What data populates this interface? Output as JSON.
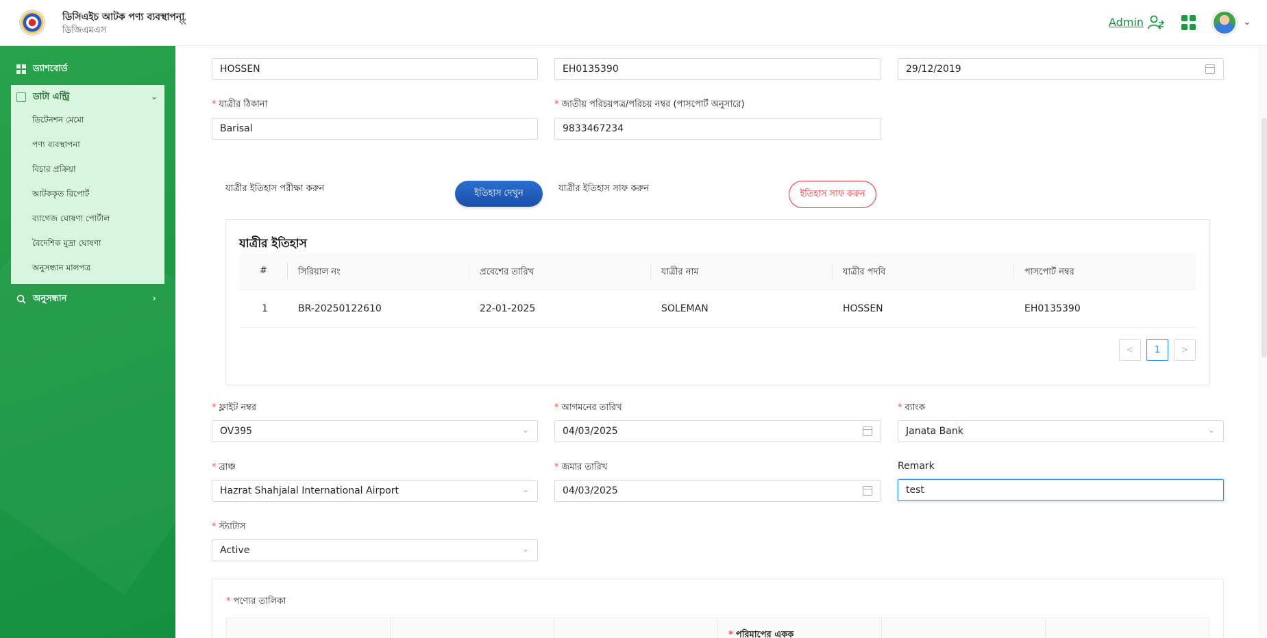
{
  "header": {
    "app_title": "ডিসিএইচ আটক পণ্য ব্যবস্থাপনা",
    "app_subtitle": "ডিজিএমএস",
    "admin_label": "Admin"
  },
  "sidebar": {
    "dashboard": "ড্যাশবোর্ড",
    "data_entry": "ডাটা এন্ট্রি",
    "submenu": [
      "ডিটেনশন মেমো",
      "পণ্য ব্যবস্থাপনা",
      "বিচার প্রক্রিয়া",
      "আটককৃত রিপোর্ট",
      "ব্যাগেজ ঘোষণা পোর্টাল",
      "বৈদেশিক মুদ্রা ঘোষণা",
      "অনুসন্ধান মালপত্র"
    ],
    "search": "অনুসন্ধান"
  },
  "form": {
    "top_row": {
      "field1_value": "HOSSEN",
      "field2_value": "EH0135390",
      "field3_value": "29/12/2019"
    },
    "address_label": "যাত্রীর ঠিকানা",
    "address_value": "Barisal",
    "nid_label": "জাতীয় পরিচয়পত্র/পরিচয় নম্বর (পাসপোর্ট অনুসারে)",
    "nid_value": "9833467234",
    "check_history_label": "যাত্রীর ইতিহাস পরীক্ষা করুন",
    "view_history_button": "ইতিহাস দেখুন",
    "clear_history_label": "যাত্রীর ইতিহাস সাফ করুন",
    "clear_history_button": "ইতিহাস সাফ করুন",
    "flight_label": "ফ্লাইট নম্বর",
    "flight_value": "OV395",
    "arrival_label": "আগমনের তারিখ",
    "arrival_value": "04/03/2025",
    "bank_label": "ব্যাংক",
    "bank_value": "Janata Bank",
    "branch_label": "ব্রাঞ্চ",
    "branch_value": "Hazrat Shahjalal International Airport",
    "deposit_label": "জমার তারিখ",
    "deposit_value": "04/03/2025",
    "remark_label": "Remark",
    "remark_value": "test",
    "status_label": "স্ট্যাটাস",
    "status_value": "Active",
    "product_list_label": "পণ্যের তালিকা",
    "unit_col_label": "পরিমাপের একক"
  },
  "history": {
    "title": "যাত্রীর ইতিহাস",
    "columns": [
      "#",
      "সিরিয়াল নং",
      "প্রবেশের তারিখ",
      "যাত্রীর নাম",
      "যাত্রীর পদবি",
      "পাসপোর্ট নম্বর"
    ],
    "rows": [
      [
        "1",
        "BR-20250122610",
        "22-01-2025",
        "SOLEMAN",
        "HOSSEN",
        "EH0135390"
      ]
    ],
    "pagination": {
      "prev": "<",
      "page": "1",
      "next": ">"
    }
  },
  "colors": {
    "sidebar_green": "#1f9a44",
    "submenu_bg": "#d8f5dd",
    "primary_blue": "#1b4fa8",
    "danger_red": "#e0333a",
    "required_red": "#ff4d4f"
  }
}
